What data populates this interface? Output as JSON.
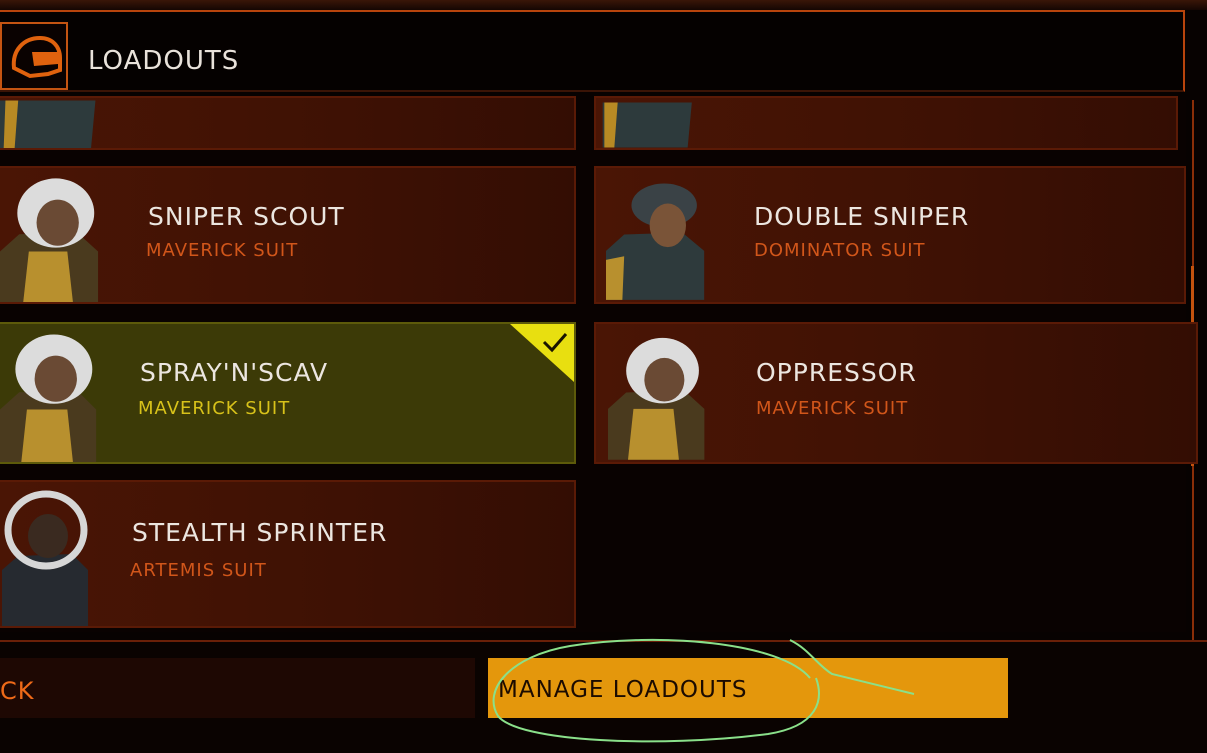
{
  "header": {
    "title": "LOADOUTS",
    "icon": "helmet-icon"
  },
  "loadouts": [
    {
      "name": "SNIPER SCOUT",
      "suit": "MAVERICK SUIT",
      "selected": false,
      "helmet": "white-helmet"
    },
    {
      "name": "DOUBLE SNIPER",
      "suit": "DOMINATOR SUIT",
      "selected": false,
      "helmet": "dark-helmet"
    },
    {
      "name": "SPRAY'N'SCAV",
      "suit": "MAVERICK SUIT",
      "selected": true,
      "helmet": "white-helmet"
    },
    {
      "name": "OPPRESSOR",
      "suit": "MAVERICK SUIT",
      "selected": false,
      "helmet": "white-helmet"
    },
    {
      "name": "STEALTH SPRINTER",
      "suit": "ARTEMIS SUIT",
      "selected": false,
      "helmet": "clear-helmet"
    }
  ],
  "footer": {
    "back_label": "CK",
    "manage_label": "MANAGE LOADOUTS"
  },
  "colors": {
    "accent": "#e4970c",
    "suit_text": "#d1561a",
    "selected_text": "#d8c21a",
    "selected_marker": "#e8df10"
  }
}
